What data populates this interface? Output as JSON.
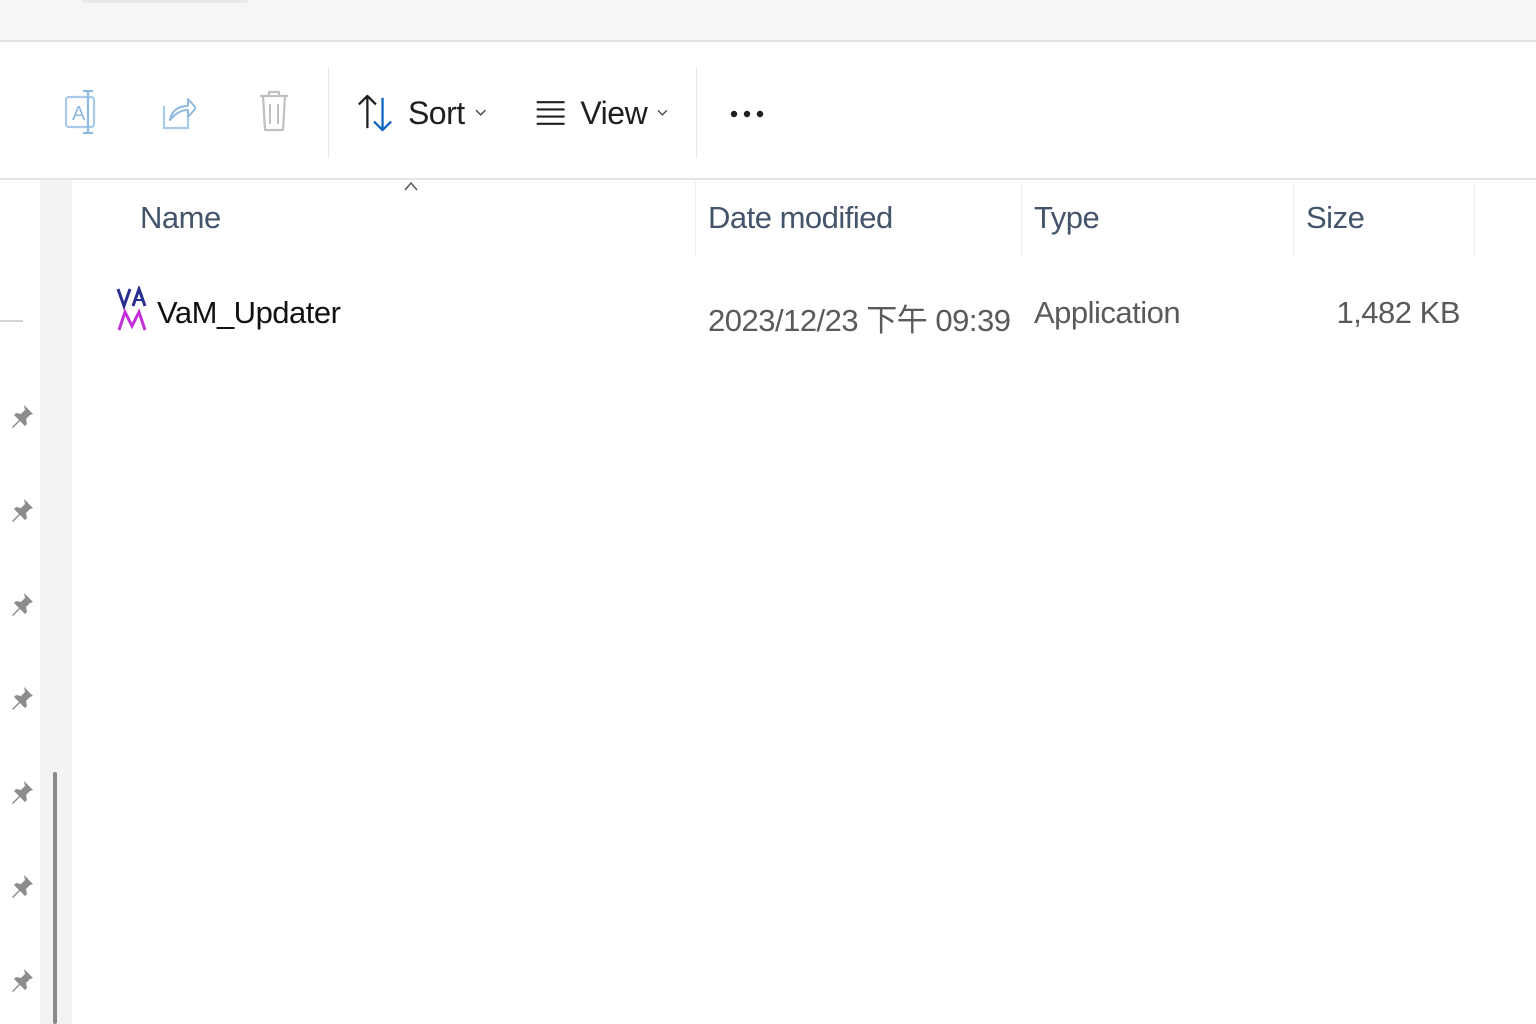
{
  "toolbar": {
    "sort_label": "Sort",
    "view_label": "View"
  },
  "columns": {
    "name": "Name",
    "date_modified": "Date modified",
    "type": "Type",
    "size": "Size"
  },
  "files": [
    {
      "name": "VaM_Updater",
      "date_modified": "2023/12/23 下午 09:39",
      "type": "Application",
      "size": "1,482 KB"
    }
  ],
  "colors": {
    "accent": "#0a66c2",
    "disabled_icon": "#9cc3e6",
    "header_text": "#44546a"
  }
}
